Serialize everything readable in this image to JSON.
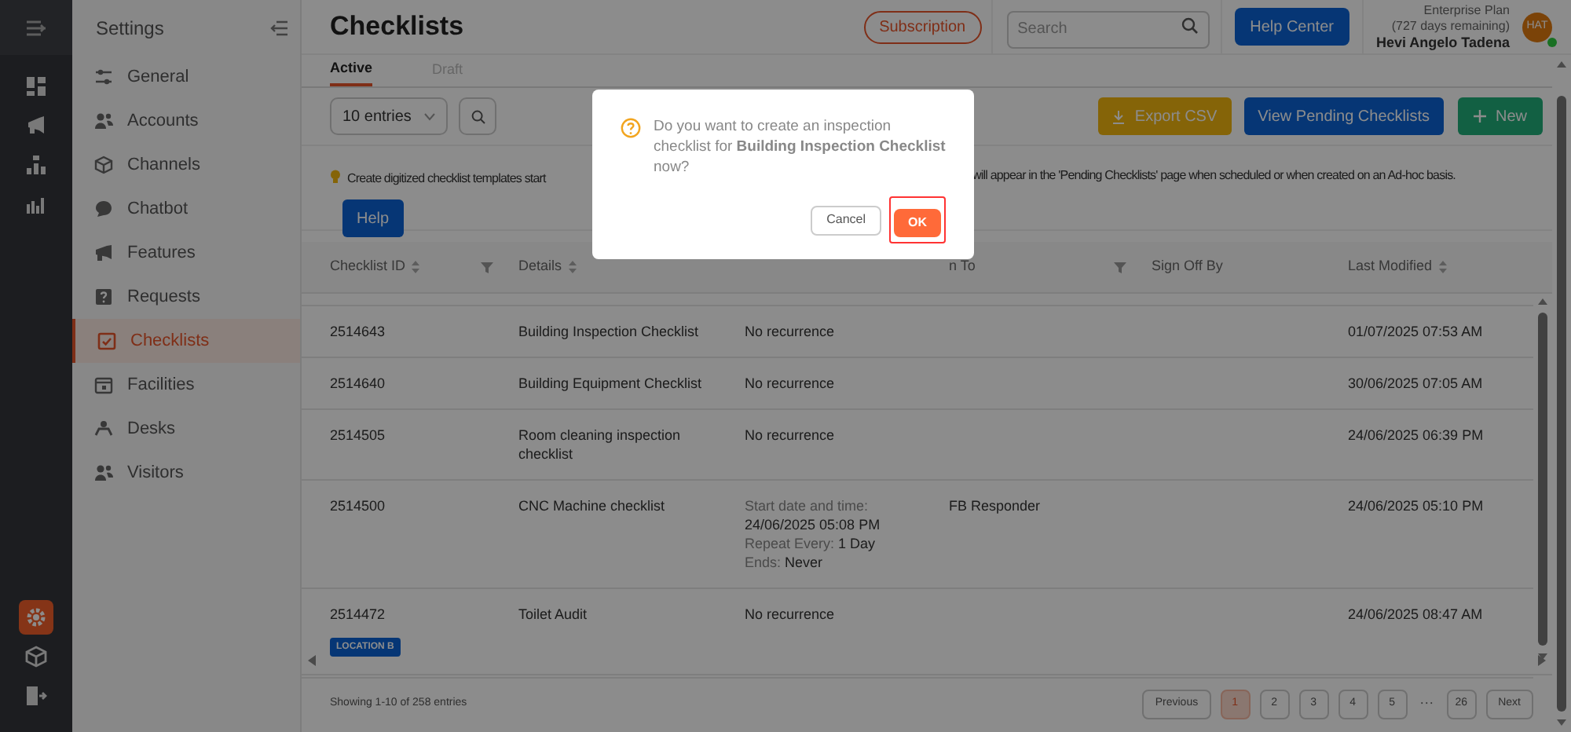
{
  "rail": {
    "items": [
      {
        "kind": "dashboard",
        "selected": false
      },
      {
        "kind": "features",
        "selected": false
      },
      {
        "kind": "hierarchy",
        "selected": false
      },
      {
        "kind": "analytics",
        "selected": false
      }
    ],
    "bottom": [
      {
        "kind": "settings",
        "selected": true
      },
      {
        "kind": "cube",
        "selected": false
      },
      {
        "kind": "logout",
        "selected": false
      }
    ]
  },
  "settings": {
    "title": "Settings",
    "items": [
      {
        "label": "General",
        "kind": "sliders",
        "selected": false
      },
      {
        "label": "Accounts",
        "kind": "users",
        "selected": false
      },
      {
        "label": "Channels",
        "kind": "cube",
        "selected": false
      },
      {
        "label": "Chatbot",
        "kind": "chat",
        "selected": false
      },
      {
        "label": "Features",
        "kind": "megaphone",
        "selected": false
      },
      {
        "label": "Requests",
        "kind": "question",
        "selected": false
      },
      {
        "label": "Checklists",
        "kind": "checklist",
        "selected": true
      },
      {
        "label": "Facilities",
        "kind": "calendar",
        "selected": false
      },
      {
        "label": "Desks",
        "kind": "desk",
        "selected": false
      },
      {
        "label": "Visitors",
        "kind": "users",
        "selected": false
      }
    ]
  },
  "header": {
    "title": "Checklists",
    "subscription": "Subscription",
    "search_placeholder": "Search",
    "help_center": "Help Center",
    "plan": "Enterprise Plan",
    "days_remaining": "(727 days remaining)",
    "user_name": "Hevi Angelo Tadena",
    "avatar_initials": "HAT",
    "online": true
  },
  "tabs": [
    {
      "label": "Active",
      "selected": true
    },
    {
      "label": "Draft",
      "selected": false
    }
  ],
  "toolbar": {
    "entries": "10 entries",
    "export": "Export CSV",
    "view_pending": "View Pending Checklists",
    "new": "New"
  },
  "info": {
    "text_start": "Create digitized checklist templates start",
    "text_end": "will appear in the 'Pending Checklists' page when scheduled or when created on an Ad-hoc basis.",
    "help": "Help"
  },
  "table": {
    "columns": [
      {
        "label": "Checklist ID",
        "sortable": true,
        "filter": true
      },
      {
        "label": "Details",
        "sortable": true
      },
      {
        "label": "n To",
        "filter": true
      },
      {
        "label": "Sign Off By"
      },
      {
        "label": "Last Modified",
        "sortable": true
      }
    ],
    "rows": [
      {
        "id": "2514643",
        "details": "Building Inspection Checklist",
        "recurrence": [
          {
            "value": "No recurrence"
          }
        ],
        "last_modified": "01/07/2025 07:53 AM"
      },
      {
        "id": "2514640",
        "details": "Building Equipment Checklist",
        "recurrence": [
          {
            "value": "No recurrence"
          }
        ],
        "last_modified": "30/06/2025 07:05 AM"
      },
      {
        "id": "2514505",
        "details": "Room cleaning inspection checklist",
        "recurrence": [
          {
            "value": "No recurrence"
          }
        ],
        "last_modified": "24/06/2025 06:39 PM"
      },
      {
        "id": "2514500",
        "details": "CNC Machine checklist",
        "recurrence": [
          {
            "label": "Start date and time:"
          },
          {
            "value": "24/06/2025 05:08 PM"
          },
          {
            "label": "Repeat Every:",
            "value": "1 Day"
          },
          {
            "label": "Ends:",
            "value": "Never"
          }
        ],
        "assigned_to": "FB Responder",
        "last_modified": "24/06/2025 05:10 PM"
      },
      {
        "id": "2514472",
        "tag": "LOCATION B",
        "details": "Toilet Audit",
        "recurrence": [
          {
            "value": "No recurrence"
          }
        ],
        "last_modified": "24/06/2025 08:47 AM"
      }
    ]
  },
  "footer": {
    "showing": "Showing 1-10 of 258 entries",
    "pages": [
      {
        "label": "Previous",
        "kind": "nav"
      },
      {
        "label": "1",
        "kind": "page",
        "selected": true
      },
      {
        "label": "2",
        "kind": "page",
        "selected": false
      },
      {
        "label": "3",
        "kind": "page",
        "selected": false
      },
      {
        "label": "4",
        "kind": "page",
        "selected": false
      },
      {
        "label": "5",
        "kind": "page",
        "selected": false
      },
      {
        "label": "···",
        "kind": "gap"
      },
      {
        "label": "26",
        "kind": "page",
        "selected": false
      },
      {
        "label": "Next",
        "kind": "nav"
      }
    ]
  },
  "dialog": {
    "text": "Do you want to create an inspection checklist for **Building Inspection Checklist** now?",
    "cancel": "Cancel",
    "ok": "OK"
  }
}
